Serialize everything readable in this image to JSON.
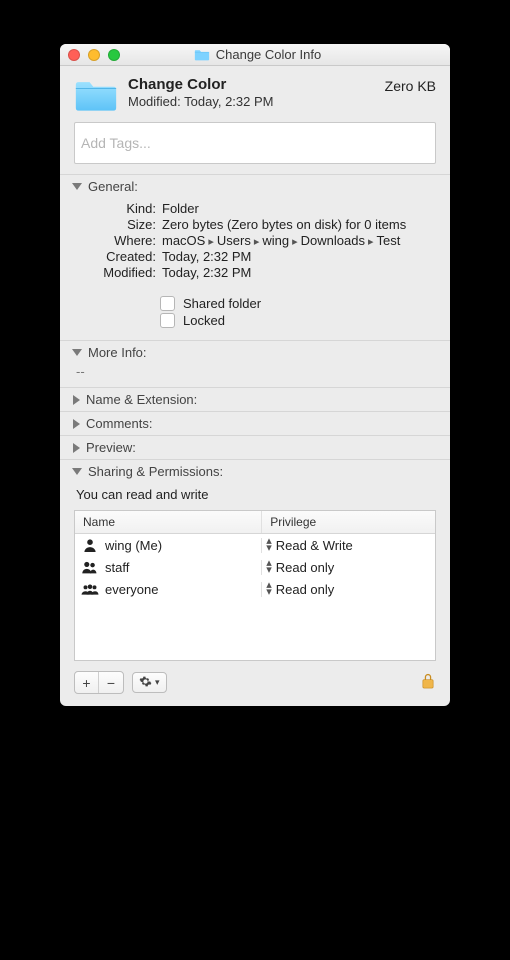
{
  "window": {
    "title": "Change Color Info"
  },
  "item": {
    "name": "Change Color",
    "size_summary": "Zero KB",
    "modified_line": "Modified: Today, 2:32 PM"
  },
  "tags": {
    "placeholder": "Add Tags..."
  },
  "sections": {
    "general_label": "General:",
    "more_info_label": "More Info:",
    "name_ext_label": "Name & Extension:",
    "comments_label": "Comments:",
    "preview_label": "Preview:",
    "sharing_label": "Sharing & Permissions:"
  },
  "general": {
    "kind_label": "Kind:",
    "kind_value": "Folder",
    "size_label": "Size:",
    "size_value": "Zero bytes (Zero bytes on disk) for 0 items",
    "where_label": "Where:",
    "where_parts": [
      "macOS",
      "Users",
      "wing",
      "Downloads",
      "Test"
    ],
    "created_label": "Created:",
    "created_value": "Today, 2:32 PM",
    "modified_label": "Modified:",
    "modified_value": "Today, 2:32 PM",
    "shared_label": "Shared folder",
    "locked_label": "Locked"
  },
  "more_info": {
    "value": "--"
  },
  "permissions": {
    "note": "You can read and write",
    "columns": {
      "name": "Name",
      "priv": "Privilege"
    },
    "rows": [
      {
        "icon": "single",
        "name": "wing (Me)",
        "priv": "Read & Write"
      },
      {
        "icon": "pair",
        "name": "staff",
        "priv": "Read only"
      },
      {
        "icon": "group",
        "name": "everyone",
        "priv": "Read only"
      }
    ]
  },
  "footer": {
    "plus": "+",
    "minus": "−"
  }
}
